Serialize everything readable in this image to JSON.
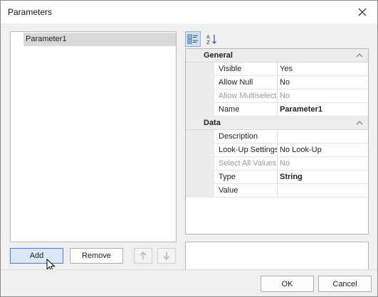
{
  "window": {
    "title": "Parameters"
  },
  "parameters": {
    "items": [
      "Parameter1"
    ]
  },
  "list_buttons": {
    "add_label": "Add",
    "remove_label": "Remove"
  },
  "property_grid": {
    "categories": [
      {
        "name": "General",
        "rows": [
          {
            "name": "Visible",
            "value": "Yes",
            "disabled": false,
            "bold": false
          },
          {
            "name": "Allow Null",
            "value": "No",
            "disabled": false,
            "bold": false
          },
          {
            "name": "Allow Multiselect",
            "value": "No",
            "disabled": true,
            "bold": false
          },
          {
            "name": "Name",
            "value": "Parameter1",
            "disabled": false,
            "bold": true
          }
        ]
      },
      {
        "name": "Data",
        "rows": [
          {
            "name": "Description",
            "value": "",
            "disabled": false,
            "bold": false
          },
          {
            "name": "Look-Up Settings",
            "value": "No Look-Up",
            "disabled": false,
            "bold": false
          },
          {
            "name": "Select All Values",
            "value": "No",
            "disabled": true,
            "bold": false
          },
          {
            "name": "Type",
            "value": "String",
            "disabled": false,
            "bold": true
          },
          {
            "name": "Value",
            "value": "",
            "disabled": false,
            "bold": false
          }
        ]
      }
    ]
  },
  "footer": {
    "ok_label": "OK",
    "cancel_label": "Cancel"
  },
  "icons": {
    "close": "close-icon",
    "categorized": "categorized-view-icon",
    "alphabetical": "alphabetical-sort-icon",
    "move_up": "arrow-up-icon",
    "move_down": "arrow-down-icon",
    "collapse": "chevron-up-icon",
    "cursor": "mouse-pointer-icon"
  },
  "colors": {
    "accent": "#3c7fd6",
    "selection": "#d9d9d9",
    "dialog_bg": "#f0f0f0"
  }
}
